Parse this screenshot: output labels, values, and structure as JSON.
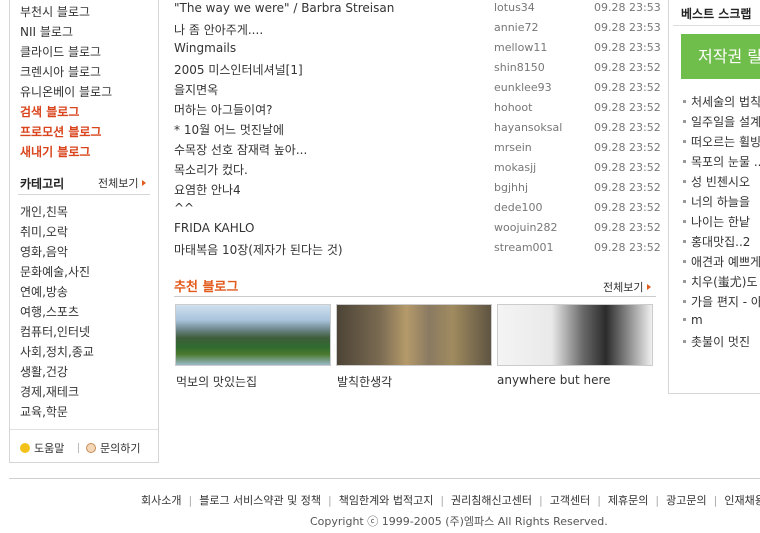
{
  "sidebar": {
    "blogs": [
      {
        "label": "부천시 블로그",
        "highlight": false
      },
      {
        "label": "NII 블로그",
        "highlight": false
      },
      {
        "label": "클라이드 블로그",
        "highlight": false
      },
      {
        "label": "크렌시아 블로그",
        "highlight": false
      },
      {
        "label": "유니온베이 블로그",
        "highlight": false
      },
      {
        "label": "검색 블로그",
        "highlight": true
      },
      {
        "label": "프로모션 블로그",
        "highlight": true
      },
      {
        "label": "새내기 블로그",
        "highlight": true
      }
    ],
    "category_title": "카테고리",
    "category_more": "전체보기",
    "categories": [
      "개인,친목",
      "취미,오락",
      "영화,음악",
      "문화예술,사진",
      "연예,방송",
      "여행,스포츠",
      "컴퓨터,인터넷",
      "사회,정치,종교",
      "생활,건강",
      "경제,재테크",
      "교육,학문"
    ],
    "help_label": "도움말",
    "ask_label": "문의하기"
  },
  "posts": [
    {
      "title": "\"The way we were\" / Barbra Streisan",
      "author": "lotus34",
      "date": "09.28 23:53"
    },
    {
      "title": "나 좀 안아주게....",
      "author": "annie72",
      "date": "09.28 23:53"
    },
    {
      "title": "Wingmails",
      "author": "mellow11",
      "date": "09.28 23:53"
    },
    {
      "title": "2005 미스인터네셔널[1]",
      "author": "shin8150",
      "date": "09.28 23:52"
    },
    {
      "title": "을지면옥",
      "author": "eunklee93",
      "date": "09.28 23:52"
    },
    {
      "title": "머하는 아그들이여?",
      "author": "hohoot",
      "date": "09.28 23:52"
    },
    {
      "title": "* 10월 어느 멋진날에",
      "author": "hayansoksal",
      "date": "09.28 23:52"
    },
    {
      "title": "수목장 선호 잠재력 높아...",
      "author": "mrsein",
      "date": "09.28 23:52"
    },
    {
      "title": "목소리가 컸다.",
      "author": "mokasjj",
      "date": "09.28 23:52"
    },
    {
      "title": "요염한 안나4",
      "author": "bgjhhj",
      "date": "09.28 23:52"
    },
    {
      "title": "^^",
      "author": "dede100",
      "date": "09.28 23:52"
    },
    {
      "title": "FRIDA KAHLO",
      "author": "woojuin282",
      "date": "09.28 23:52"
    },
    {
      "title": "마태복음 10장(제자가 된다는 것)",
      "author": "stream001",
      "date": "09.28 23:52"
    }
  ],
  "recommended": {
    "title": "추천 블로그",
    "more": "전체보기",
    "items": [
      {
        "caption": "먹보의 맛있는집"
      },
      {
        "caption": "발칙한생각"
      },
      {
        "caption": "anywhere but here"
      }
    ]
  },
  "best": {
    "title": "베스트 스크랩",
    "banner": "저작권 릴",
    "items": [
      "처세술의 법칙",
      "일주일을 설계",
      "떠오르는 휠빙",
      "목포의 눈물 ..",
      "성 빈첸시오",
      "너의 하늘을",
      "나이는 한낱",
      "홍대맛집..2",
      "애견과 예쁘게",
      "치우(蚩尤)도",
      "가을 편지 - 아",
      "m",
      "촛불이 멋진"
    ]
  },
  "footer": {
    "links": [
      "회사소개",
      "블로그 서비스약관 및 정책",
      "책임한계와 법적고지",
      "권리침해신고센터",
      "고객센터",
      "제휴문의",
      "광고문의",
      "인재채용"
    ],
    "copyright": "Copyright ⓒ 1999-2005 (주)엠파스 All Rights Reserved."
  }
}
